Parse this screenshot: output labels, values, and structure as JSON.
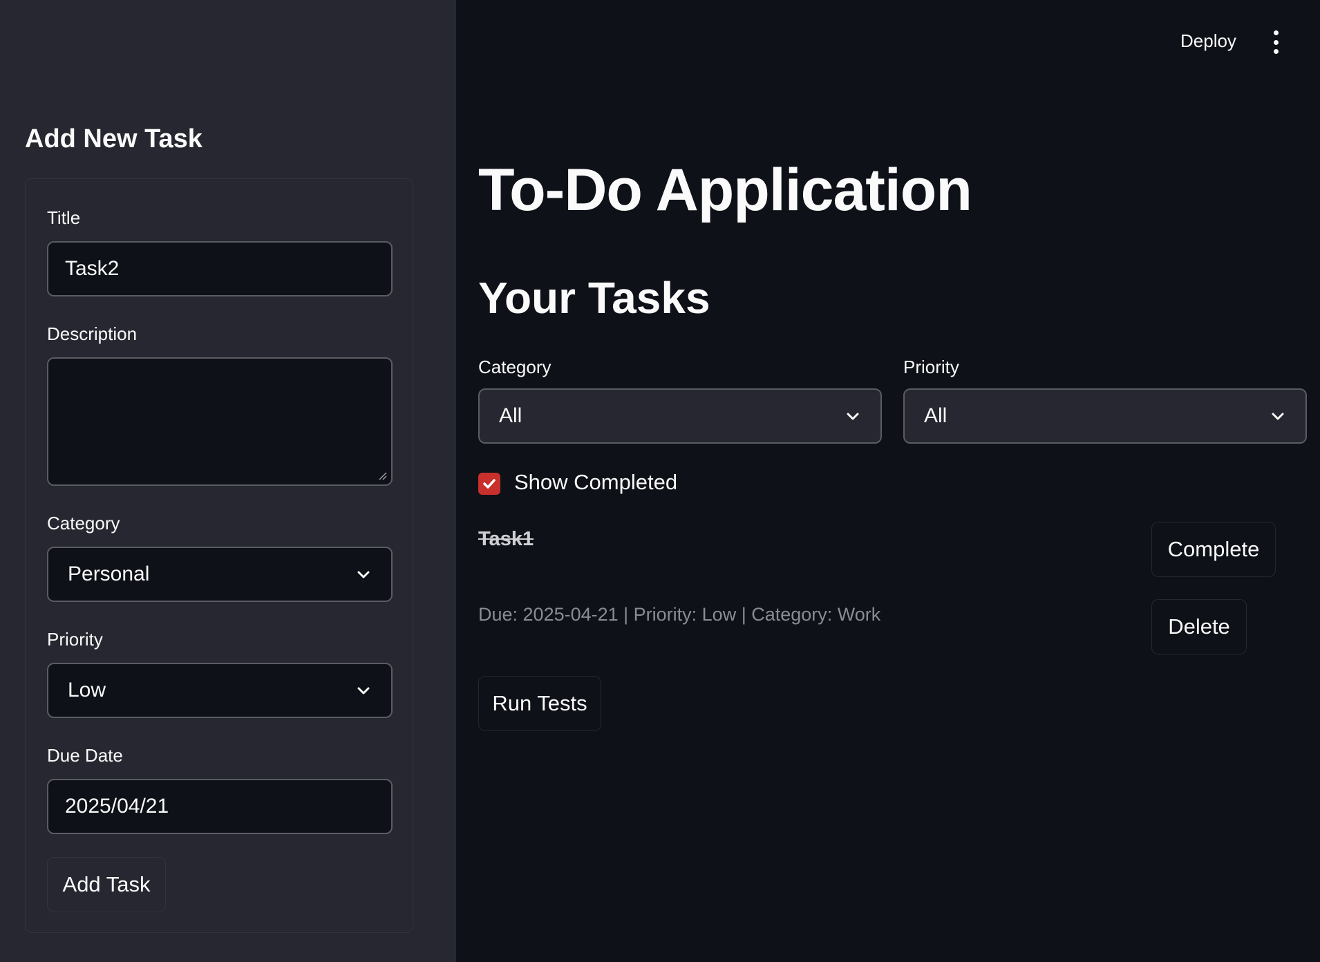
{
  "header": {
    "deploy_label": "Deploy",
    "menu_icon": "kebab-vertical-icon"
  },
  "sidebar": {
    "title": "Add New Task",
    "form": {
      "title_label": "Title",
      "title_value": "Task2",
      "description_label": "Description",
      "description_value": "",
      "category_label": "Category",
      "category_value": "Personal",
      "priority_label": "Priority",
      "priority_value": "Low",
      "due_date_label": "Due Date",
      "due_date_value": "2025/04/21",
      "add_button_label": "Add Task"
    }
  },
  "main": {
    "title": "To-Do Application",
    "section_title": "Your Tasks",
    "filters": {
      "category_label": "Category",
      "category_value": "All",
      "priority_label": "Priority",
      "priority_value": "All",
      "show_completed_label": "Show Completed",
      "show_completed_checked": true
    },
    "tasks": [
      {
        "title": "Task1",
        "completed": true,
        "meta": "Due: 2025-04-21 | Priority: Low | Category: Work",
        "complete_label": "Complete",
        "delete_label": "Delete"
      }
    ],
    "run_tests_label": "Run Tests"
  },
  "colors": {
    "background": "#0e1117",
    "sidebar": "#262730",
    "accent": "#c8302c",
    "text": "#fafafa",
    "muted": "#8a8c94"
  }
}
